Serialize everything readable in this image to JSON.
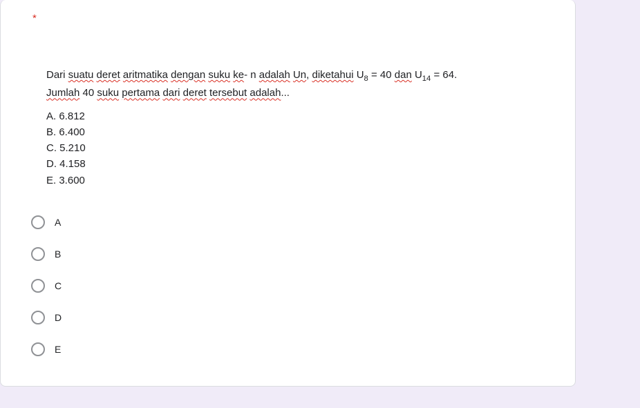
{
  "required_marker": "*",
  "question": {
    "line1_parts": [
      {
        "t": "Dari ",
        "wave": false
      },
      {
        "t": "suatu",
        "wave": true
      },
      {
        "t": " ",
        "wave": false
      },
      {
        "t": "deret",
        "wave": true
      },
      {
        "t": " ",
        "wave": false
      },
      {
        "t": "aritmatika",
        "wave": true
      },
      {
        "t": " ",
        "wave": false
      },
      {
        "t": "dengan",
        "wave": true
      },
      {
        "t": " ",
        "wave": false
      },
      {
        "t": "suku",
        "wave": true
      },
      {
        "t": " ",
        "wave": false
      },
      {
        "t": "ke",
        "wave": true
      },
      {
        "t": "- n ",
        "wave": false
      },
      {
        "t": "adalah",
        "wave": true
      },
      {
        "t": " ",
        "wave": false
      },
      {
        "t": "Un",
        "wave": true
      },
      {
        "t": ", ",
        "wave": false
      },
      {
        "t": "diketahui",
        "wave": true
      },
      {
        "t": " U",
        "wave": false
      }
    ],
    "sub1": "8",
    "mid1": " = 40 ",
    "dan": {
      "t": "dan",
      "wave": true
    },
    "mid2": " U",
    "sub2": "14",
    "end1": " = 64.",
    "line2_parts": [
      {
        "t": "Jumlah",
        "wave": true
      },
      {
        "t": " 40 ",
        "wave": false
      },
      {
        "t": "suku",
        "wave": true
      },
      {
        "t": " ",
        "wave": false
      },
      {
        "t": "pertama",
        "wave": true
      },
      {
        "t": " ",
        "wave": false
      },
      {
        "t": "dari",
        "wave": true
      },
      {
        "t": " ",
        "wave": false
      },
      {
        "t": "deret",
        "wave": true
      },
      {
        "t": " ",
        "wave": false
      },
      {
        "t": "tersebut",
        "wave": true
      },
      {
        "t": " ",
        "wave": false
      },
      {
        "t": "adalah",
        "wave": true
      },
      {
        "t": "...",
        "wave": false
      }
    ],
    "answers": [
      "A.  6.812",
      "B.  6.400",
      "C.  5.210",
      "D.  4.158",
      "E.  3.600"
    ]
  },
  "options": [
    "A",
    "B",
    "C",
    "D",
    "E"
  ]
}
